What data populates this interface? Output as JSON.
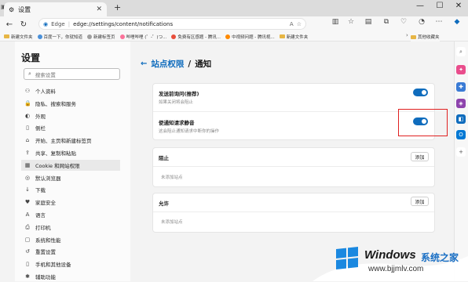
{
  "tab": {
    "title": "设置",
    "close": "✕",
    "new_tab": "+"
  },
  "window_controls": {
    "minimize": "—",
    "maximize": "☐",
    "close": "✕"
  },
  "address_bar": {
    "site_label": "Edge",
    "separator": "|",
    "url": "edge://settings/content/notifications"
  },
  "bookmarks": {
    "items": [
      {
        "label": "新建文件夹",
        "type": "folder"
      },
      {
        "label": "百度一下，你就知道",
        "type": "link"
      },
      {
        "label": "新建标签页",
        "type": "link"
      },
      {
        "label": "哔哩哔哩 (゜-゜)つ...",
        "type": "link"
      },
      {
        "label": "免费有区感题 - 腾讯...",
        "type": "link"
      },
      {
        "label": "中视频问题 - 腾讯视...",
        "type": "link"
      },
      {
        "label": "新建文件夹",
        "type": "folder"
      }
    ],
    "right": {
      "label": "其他收藏夹",
      "chevron": "›"
    }
  },
  "settings": {
    "title": "设置",
    "search_placeholder": "搜索设置",
    "nav": [
      {
        "label": "个人资料",
        "icon": "person-icon",
        "glyph": "⚇"
      },
      {
        "label": "隐私、搜索和服务",
        "icon": "lock-icon",
        "glyph": "🔒"
      },
      {
        "label": "外观",
        "icon": "palette-icon",
        "glyph": "◐"
      },
      {
        "label": "侧栏",
        "icon": "sidebar-icon",
        "glyph": "▯"
      },
      {
        "label": "开始、主页和新建标签页",
        "icon": "home-icon",
        "glyph": "⌂"
      },
      {
        "label": "共享、复制和粘贴",
        "icon": "share-icon",
        "glyph": "⇪"
      },
      {
        "label": "Cookie 和网站权限",
        "icon": "cookie-icon",
        "glyph": "▦",
        "active": true
      },
      {
        "label": "默认浏览器",
        "icon": "browser-icon",
        "glyph": "◎"
      },
      {
        "label": "下载",
        "icon": "download-icon",
        "glyph": "↓"
      },
      {
        "label": "家庭安全",
        "icon": "family-icon",
        "glyph": "♥"
      },
      {
        "label": "语言",
        "icon": "language-icon",
        "glyph": "A"
      },
      {
        "label": "打印机",
        "icon": "printer-icon",
        "glyph": "⎙"
      },
      {
        "label": "系统和性能",
        "icon": "system-icon",
        "glyph": "▢"
      },
      {
        "label": "重置设置",
        "icon": "reset-icon",
        "glyph": "↺"
      },
      {
        "label": "手机和其他设备",
        "icon": "phone-icon",
        "glyph": "▯"
      },
      {
        "label": "辅助功能",
        "icon": "accessibility-icon",
        "glyph": "✱"
      }
    ]
  },
  "content": {
    "back": "←",
    "breadcrumb_link": "站点权限",
    "breadcrumb_sep": "/",
    "breadcrumb_current": "通知",
    "ask_before_sending": {
      "title": "发送前询问(推荐)",
      "subtitle": "如果关闭将会阻止",
      "on": true
    },
    "quiet_requests": {
      "title": "使通知请求静音",
      "subtitle": "这会阻止通知请求中断你的操作",
      "on": true
    },
    "block": {
      "title": "阻止",
      "add": "添加",
      "empty": "未添加站点"
    },
    "allow": {
      "title": "允许",
      "add": "添加",
      "empty": "未添加站点"
    }
  },
  "watermark": {
    "brand": "Windows",
    "brand_suffix": "系统之家",
    "url": "www.bjjmlv.com"
  },
  "colors": {
    "accent": "#0f6cbd",
    "highlight": "#e02020"
  }
}
